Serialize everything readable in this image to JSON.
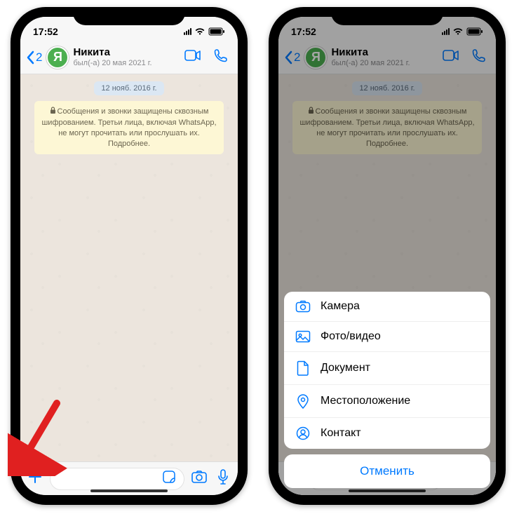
{
  "status": {
    "time": "17:52"
  },
  "header": {
    "back_count": "2",
    "avatar_letter": "Я",
    "contact_name": "Никита",
    "contact_subtitle": "был(-а) 20 мая 2021 г."
  },
  "chat": {
    "date_chip": "12 нояб. 2016 г.",
    "encryption_notice": "Сообщения и звонки защищены сквозным шифрованием. Третьи лица, включая WhatsApp, не могут прочитать или прослушать их. Подробнее."
  },
  "attach_menu": {
    "camera": "Камера",
    "gallery": "Фото/видео",
    "document": "Документ",
    "location": "Местоположение",
    "contact": "Контакт",
    "cancel": "Отменить"
  },
  "colors": {
    "ios_blue": "#007aff",
    "arrow_red": "#e02020"
  }
}
